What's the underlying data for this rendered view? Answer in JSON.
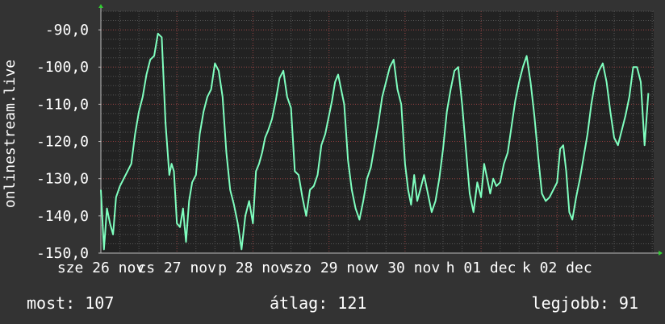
{
  "chart_data": {
    "type": "line",
    "ylabel": "onlinestream.live",
    "ylim": [
      -150,
      -85
    ],
    "yticks": [
      -90,
      -100,
      -110,
      -120,
      -130,
      -140,
      -150
    ],
    "ytick_labels": [
      "-90,0",
      "-100,0",
      "-110,0",
      "-120,0",
      "-130,0",
      "-140,0",
      "-150,0"
    ],
    "x_ticks": [
      {
        "t": 0.0,
        "label": "sze 26 nov"
      },
      {
        "t": 1.0,
        "label": "cs 27 nov"
      },
      {
        "t": 2.0,
        "label": "p 28 nov"
      },
      {
        "t": 3.0,
        "label": "szo 29 nov"
      },
      {
        "t": 4.0,
        "label": "v 30 nov"
      },
      {
        "t": 5.0,
        "label": "h 01 dec"
      },
      {
        "t": 6.0,
        "label": "k 02 dec"
      }
    ],
    "xlim": [
      0,
      7.27
    ],
    "series": [
      {
        "color": "#7fffbf",
        "x": [
          0.0,
          0.04,
          0.08,
          0.12,
          0.16,
          0.2,
          0.25,
          0.3,
          0.35,
          0.4,
          0.45,
          0.5,
          0.55,
          0.6,
          0.65,
          0.7,
          0.75,
          0.8,
          0.85,
          0.9,
          0.93,
          0.96,
          1.0,
          1.04,
          1.08,
          1.12,
          1.16,
          1.2,
          1.25,
          1.3,
          1.35,
          1.4,
          1.45,
          1.5,
          1.55,
          1.6,
          1.65,
          1.7,
          1.75,
          1.8,
          1.85,
          1.9,
          1.95,
          2.0,
          2.04,
          2.08,
          2.12,
          2.16,
          2.2,
          2.25,
          2.3,
          2.35,
          2.4,
          2.45,
          2.5,
          2.55,
          2.6,
          2.65,
          2.7,
          2.75,
          2.8,
          2.85,
          2.9,
          2.95,
          3.0,
          3.04,
          3.08,
          3.12,
          3.16,
          3.2,
          3.25,
          3.3,
          3.35,
          3.4,
          3.45,
          3.5,
          3.55,
          3.6,
          3.65,
          3.7,
          3.75,
          3.8,
          3.85,
          3.9,
          3.95,
          4.0,
          4.04,
          4.08,
          4.12,
          4.16,
          4.2,
          4.25,
          4.3,
          4.35,
          4.4,
          4.45,
          4.5,
          4.55,
          4.6,
          4.65,
          4.7,
          4.75,
          4.8,
          4.85,
          4.9,
          4.95,
          5.0,
          5.04,
          5.08,
          5.12,
          5.16,
          5.2,
          5.25,
          5.3,
          5.35,
          5.4,
          5.45,
          5.5,
          5.55,
          5.6,
          5.65,
          5.7,
          5.75,
          5.8,
          5.85,
          5.9,
          5.95,
          6.0,
          6.04,
          6.08,
          6.12,
          6.16,
          6.2,
          6.25,
          6.3,
          6.35,
          6.4,
          6.45,
          6.5,
          6.55,
          6.6,
          6.65,
          6.7,
          6.75,
          6.8,
          6.85,
          6.9,
          6.95,
          7.0,
          7.05,
          7.1,
          7.15,
          7.2
        ],
        "y": [
          -133,
          -149,
          -138,
          -142,
          -145,
          -135,
          -132,
          -130,
          -128,
          -126,
          -118,
          -112,
          -108,
          -102,
          -98,
          -97,
          -91,
          -92,
          -115,
          -129,
          -126,
          -128,
          -142,
          -143,
          -138,
          -147,
          -136,
          -131,
          -129,
          -118,
          -112,
          -108,
          -106,
          -99,
          -101,
          -108,
          -123,
          -133,
          -137,
          -142,
          -149,
          -140,
          -136,
          -142,
          -128,
          -126,
          -123,
          -119,
          -117,
          -114,
          -109,
          -103,
          -101,
          -108,
          -111,
          -128,
          -129,
          -135,
          -140,
          -133,
          -132,
          -129,
          -121,
          -118,
          -113,
          -109,
          -104,
          -102,
          -106,
          -110,
          -125,
          -133,
          -138,
          -141,
          -136,
          -130,
          -127,
          -121,
          -115,
          -108,
          -104,
          -100,
          -98,
          -106,
          -110,
          -126,
          -133,
          -137,
          -129,
          -136,
          -133,
          -129,
          -134,
          -139,
          -136,
          -130,
          -122,
          -112,
          -106,
          -101,
          -100,
          -110,
          -122,
          -134,
          -139,
          -131,
          -135,
          -126,
          -130,
          -134,
          -130,
          -132,
          -131,
          -126,
          -123,
          -116,
          -109,
          -104,
          -100,
          -97,
          -104,
          -113,
          -124,
          -134,
          -136,
          -135,
          -133,
          -131,
          -122,
          -121,
          -128,
          -139,
          -141,
          -135,
          -130,
          -124,
          -118,
          -110,
          -104,
          -101,
          -99,
          -104,
          -112,
          -119,
          -121,
          -117,
          -113,
          -108,
          -100,
          -100,
          -104,
          -121,
          -107
        ]
      }
    ]
  },
  "stats": {
    "now": "most: 107",
    "avg": "átlag: 121",
    "best": "legjobb: 91"
  }
}
